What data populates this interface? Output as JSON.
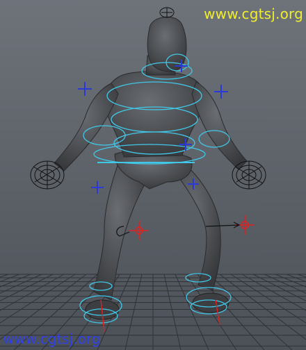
{
  "viewport": {
    "watermark_top": "www.cgtsj.org",
    "watermark_bottom": "www.cgtsj.org"
  },
  "colors": {
    "background_top": "#6e737a",
    "background_bottom": "#4c5158",
    "grid": "#2f3236",
    "body": "#4a4c50",
    "body_shade": "#35373a",
    "control_curve": "#40c8e8",
    "locator": "#2a3ad8",
    "ik_handle": "#e02020",
    "watermark_top": "#f0ee30",
    "watermark_bottom": "#3040e0"
  },
  "icons": {
    "locator": "plus-cross",
    "ik_handle": "crosshair",
    "pole_vector": "arrow"
  }
}
